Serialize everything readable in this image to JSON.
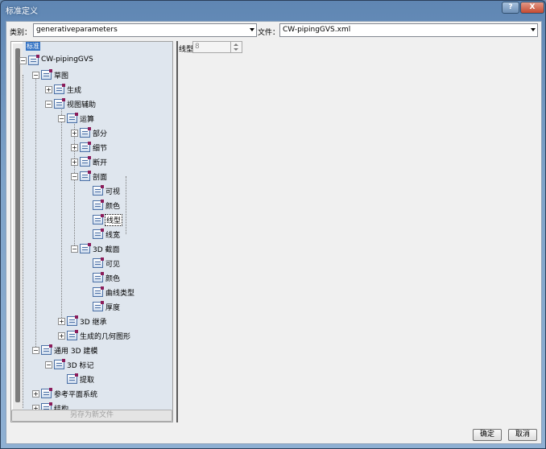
{
  "window": {
    "title": "标准定义",
    "help_label": "?",
    "close_label": "X"
  },
  "category": {
    "label": "类别：",
    "value": "generativeparameters"
  },
  "file": {
    "label": "文件：",
    "value": "CW-pipingGVS.xml"
  },
  "tree": {
    "root_label": "标准",
    "nodes": [
      {
        "label": "CW-pipingGVS",
        "exp": "-"
      },
      {
        "label": "草图",
        "exp": "-"
      },
      {
        "label": "生成",
        "exp": "+"
      },
      {
        "label": "视图辅助",
        "exp": "-"
      },
      {
        "label": "运算",
        "exp": "-"
      },
      {
        "label": "部分",
        "exp": "+"
      },
      {
        "label": "细节",
        "exp": "+"
      },
      {
        "label": "断开",
        "exp": "+"
      },
      {
        "label": "剖面",
        "exp": "-"
      },
      {
        "label": "可视",
        "exp": ""
      },
      {
        "label": "颜色",
        "exp": ""
      },
      {
        "label": "线型",
        "exp": ""
      },
      {
        "label": "线宽",
        "exp": ""
      },
      {
        "label": "3D 截面",
        "exp": "-"
      },
      {
        "label": "可见",
        "exp": ""
      },
      {
        "label": "颜色",
        "exp": ""
      },
      {
        "label": "曲线类型",
        "exp": ""
      },
      {
        "label": "厚度",
        "exp": ""
      },
      {
        "label": "3D 继承",
        "exp": "+"
      },
      {
        "label": "生成的几何图形",
        "exp": "+"
      },
      {
        "label": "通用 3D 建模",
        "exp": "-"
      },
      {
        "label": "3D 标记",
        "exp": "-"
      },
      {
        "label": "提取",
        "exp": ""
      },
      {
        "label": "参考平面系统",
        "exp": "+"
      },
      {
        "label": "结构",
        "exp": "+"
      }
    ]
  },
  "save_as_label": "另存为新文件",
  "parameter": {
    "label": "线型",
    "value": "8"
  },
  "buttons": {
    "ok": "确定",
    "cancel": "取消"
  }
}
